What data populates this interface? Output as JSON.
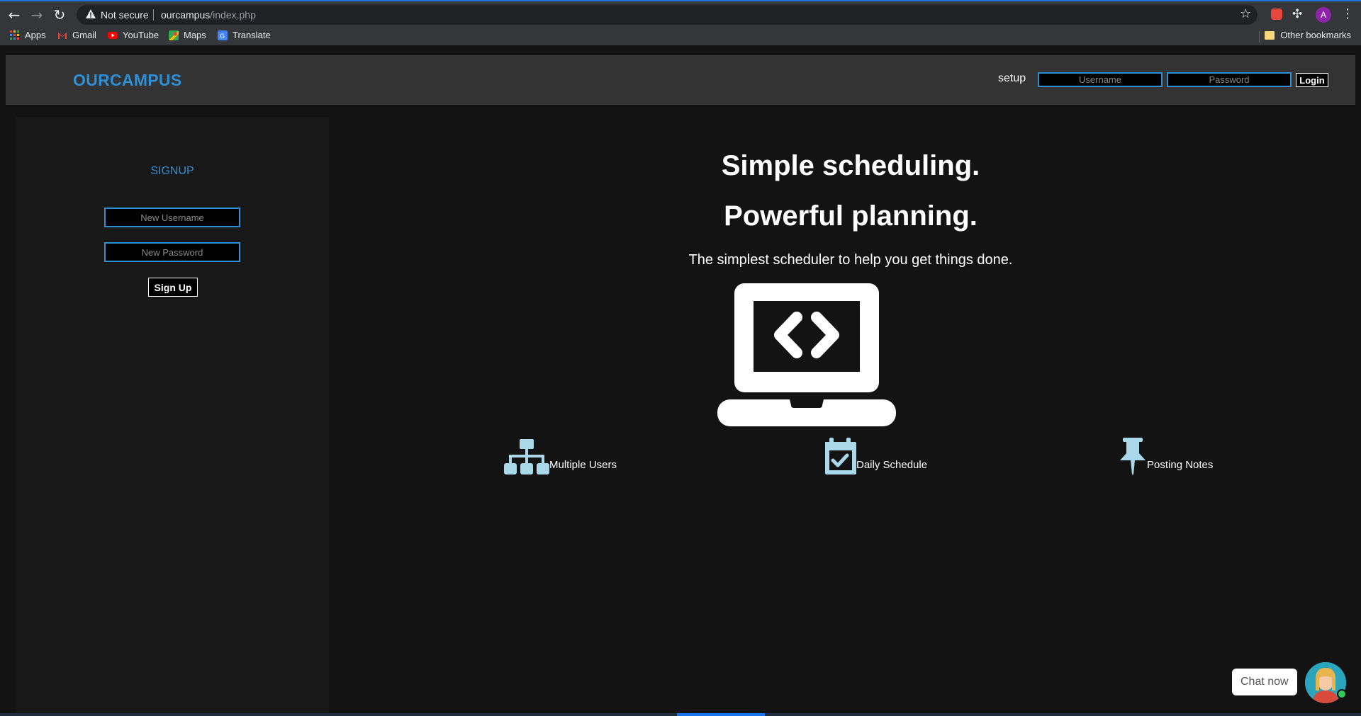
{
  "browser": {
    "not_secure": "Not secure",
    "url_host": "ourcampus",
    "url_path": "/index.php",
    "profile_initial": "A",
    "bookmarks": [
      {
        "label": "Apps",
        "color": "#ea4335"
      },
      {
        "label": "Gmail",
        "color": "#ea4335"
      },
      {
        "label": "YouTube",
        "color": "#ff0000"
      },
      {
        "label": "Maps",
        "color": "#34a853"
      },
      {
        "label": "Translate",
        "color": "#4285f4"
      }
    ],
    "other_bookmarks": "Other bookmarks"
  },
  "header": {
    "brand": "OURCAMPUS",
    "setup_link": "setup",
    "username_placeholder": "Username",
    "password_placeholder": "Password",
    "login_label": "Login"
  },
  "signup": {
    "title": "SIGNUP",
    "username_placeholder": "New Username",
    "password_placeholder": "New Password",
    "button_label": "Sign Up"
  },
  "hero": {
    "headline_1": "Simple scheduling.",
    "headline_2": "Powerful planning.",
    "subheadline": "The simplest scheduler to help you get things done.",
    "icon": "laptop-code-icon"
  },
  "features": [
    {
      "label": "Multiple Users",
      "icon": "sitemap-icon"
    },
    {
      "label": "Daily Schedule",
      "icon": "calendar-check-icon"
    },
    {
      "label": "Posting Notes",
      "icon": "thumbtack-icon"
    }
  ],
  "chat": {
    "label": "Chat now"
  },
  "colors": {
    "accent": "#2e8fd5",
    "feature_icon": "#a8d8ea",
    "background": "#131313",
    "header_bg": "#333333"
  }
}
